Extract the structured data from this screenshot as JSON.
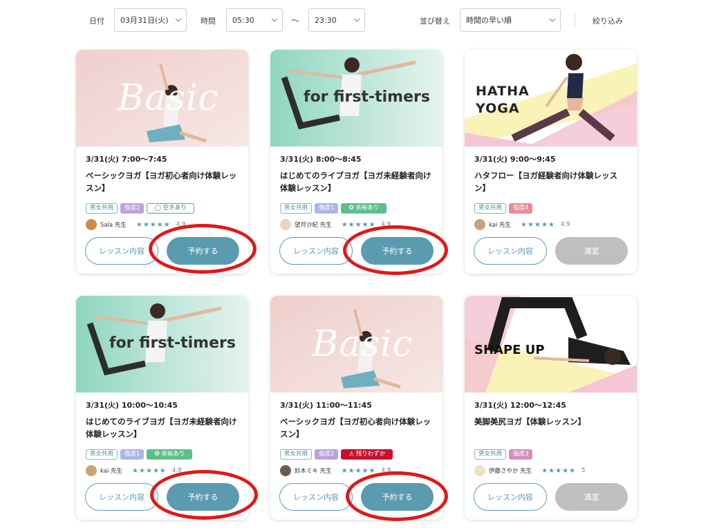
{
  "filters": {
    "date_label": "日付",
    "date_value": "03月31日(火)",
    "time_label": "時間",
    "time_from": "05:30",
    "tilde": "〜",
    "time_to": "23:30",
    "sort_label": "並び替え",
    "sort_value": "時間の早い順",
    "refine": "絞り込み"
  },
  "colors": {
    "accent": "#5a9bb0",
    "full": "#bfbfbf",
    "highlight": "#e01818"
  },
  "lessons": [
    {
      "overlay": "Basic",
      "time": "3/31(火) 7:00〜7:45",
      "title": "ベーシックヨガ【ヨガ初心者向け体験レッスン】",
      "gender_tag": "男女共用",
      "intensity": "強度2",
      "intensity_color": "#b9a2dd",
      "status": "◯ 空きあり",
      "instructor": "Sala 先生",
      "stars": "★★★★★",
      "rating": "4.9",
      "detail_label": "レッスン内容",
      "action_label": "予約する",
      "full": false,
      "highlighted": true
    },
    {
      "overlay": "for first-timers",
      "time": "3/31(火) 8:00〜8:45",
      "title": "はじめてのライブヨガ【ヨガ未経験者向け体験レッスン】",
      "gender_tag": "男女共用",
      "intensity": "強度1",
      "intensity_color": "#a9b6e8",
      "status": "✪ 余裕あり",
      "instructor": "望月沙紀 先生",
      "stars": "★★★★★",
      "rating": "4.9",
      "detail_label": "レッスン内容",
      "action_label": "予約する",
      "full": false,
      "highlighted": true
    },
    {
      "overlay": "HATHA\nYOGA",
      "time": "3/31(火) 9:00〜9:45",
      "title": "ハタフロー【ヨガ経験者向け体験レッスン】",
      "gender_tag": "男女共用",
      "intensity": "強度4",
      "intensity_color": "#e88b94",
      "status": "",
      "instructor": "kai 先生",
      "stars": "★★★★★",
      "rating": "4.9",
      "detail_label": "レッスン内容",
      "action_label": "満室",
      "full": true,
      "highlighted": false
    },
    {
      "overlay": "for first-timers",
      "time": "3/31(火) 10:00〜10:45",
      "title": "はじめてのライブヨガ【ヨガ未経験者向け体験レッスン】",
      "gender_tag": "男女共用",
      "intensity": "強度1",
      "intensity_color": "#a9b6e8",
      "status": "✪ 余裕あり",
      "instructor": "kai 先生",
      "stars": "★★★★★",
      "rating": "4.9",
      "detail_label": "レッスン内容",
      "action_label": "予約する",
      "full": false,
      "highlighted": true
    },
    {
      "overlay": "Basic",
      "time": "3/31(火) 11:00〜11:45",
      "title": "ベーシックヨガ【ヨガ初心者向け体験レッスン】",
      "gender_tag": "男女共用",
      "intensity": "強度2",
      "intensity_color": "#b9a2dd",
      "status": "⚠ 残りわずか",
      "instructor": "鈴木ミキ 先生",
      "stars": "★★★★★",
      "rating": "4.9",
      "detail_label": "レッスン内容",
      "action_label": "予約する",
      "full": false,
      "highlighted": true
    },
    {
      "overlay": "SHAPE UP",
      "time": "3/31(火) 12:00〜12:45",
      "title": "美脚美尻ヨガ【体験レッスン】",
      "gender_tag": "男女共用",
      "intensity": "強度3",
      "intensity_color": "#d58fbf",
      "status": "",
      "instructor": "伊藤さやか 先生",
      "stars": "★★★★★",
      "rating": "5",
      "detail_label": "レッスン内容",
      "action_label": "満室",
      "full": true,
      "highlighted": false
    }
  ]
}
